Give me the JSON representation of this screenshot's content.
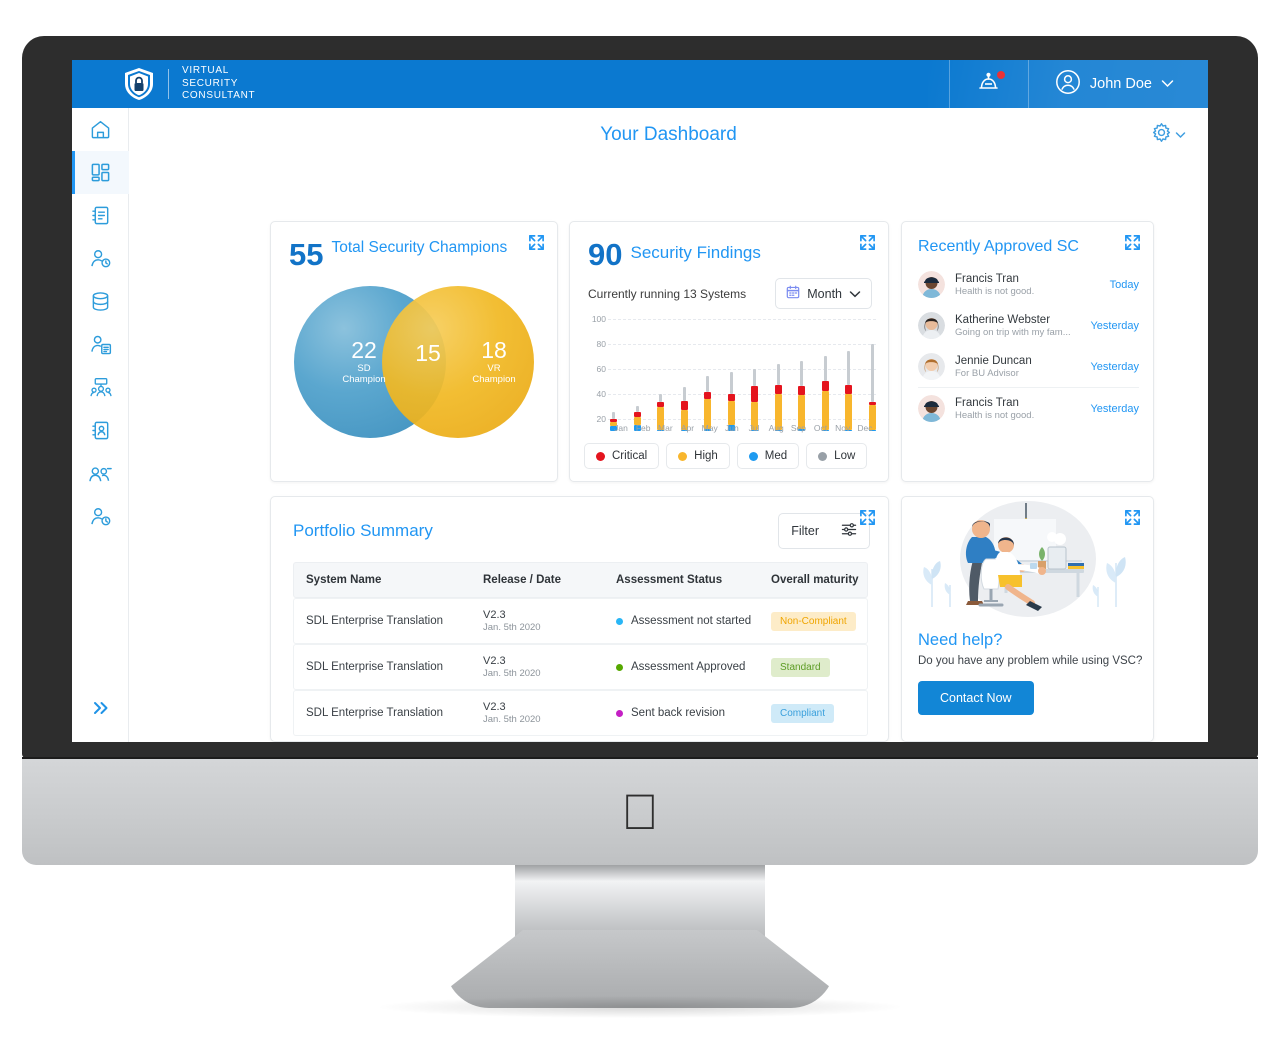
{
  "brand": {
    "line1": "VIRTUAL",
    "line2": "SECURITY",
    "line3": "CONSULTANT",
    "shield_icon": "shield-lock-icon"
  },
  "header": {
    "bell_icon": "service-bell-icon",
    "has_notification": true,
    "avatar_icon": "user-circle-icon",
    "user_name": "John Doe",
    "chevron_icon": "chevron-down-icon",
    "bg_color": "#0b79d0"
  },
  "sidebar": {
    "items": [
      {
        "icon": "home-icon",
        "name": "home",
        "active": false
      },
      {
        "icon": "dashboard-grid-icon",
        "name": "dashboard",
        "active": true
      },
      {
        "icon": "notebook-icon",
        "name": "notebook",
        "active": false
      },
      {
        "icon": "user-settings-icon",
        "name": "user-settings",
        "active": false
      },
      {
        "icon": "database-icon",
        "name": "database",
        "active": false
      },
      {
        "icon": "user-card-icon",
        "name": "user-card",
        "active": false
      },
      {
        "icon": "team-presentation-icon",
        "name": "team-presentation",
        "active": false
      },
      {
        "icon": "contact-book-icon",
        "name": "contact-book",
        "active": false
      },
      {
        "icon": "users-group-icon",
        "name": "users-group",
        "active": false
      },
      {
        "icon": "user-clock-icon",
        "name": "user-clock",
        "active": false
      }
    ],
    "collapse_icon": "double-chevron-right-icon"
  },
  "page": {
    "title": "Your Dashboard",
    "settings_icon": "gear-icon",
    "settings_chevron": "chevron-down-icon",
    "title_color": "#2196f3"
  },
  "champions_card": {
    "count": "55",
    "label": "Total Security Champions",
    "expand_icon": "expand-icon",
    "venn": {
      "left_value": "22",
      "left_label_1": "SD",
      "left_label_2": "Champion",
      "left_color": "#5ba7cf",
      "overlap_value": "15",
      "right_value": "18",
      "right_label_1": "VR",
      "right_label_2": "Champion",
      "right_color": "#f1b924"
    }
  },
  "findings_card": {
    "count": "90",
    "label": "Security Findings",
    "subtitle": "Currently running 13 Systems",
    "expand_icon": "expand-icon",
    "range_selector": {
      "icon": "calendar-icon",
      "value": "Month",
      "chevron": "chevron-down-icon"
    }
  },
  "chart_data": {
    "type": "bar",
    "title": "Security Findings",
    "subtitle": "Currently running 13 Systems",
    "xlabel": "",
    "ylabel": "",
    "ylim": [
      20,
      100
    ],
    "yticks": [
      20,
      40,
      60,
      80,
      100
    ],
    "grid": true,
    "stacked": true,
    "legend_position": "bottom",
    "categories": [
      "Jan",
      "Feb",
      "Mar",
      "Apr",
      "May",
      "Jun",
      "Jul",
      "Aug",
      "Sep",
      "Oct",
      "Nov",
      "Dec"
    ],
    "series": [
      {
        "name": "Med",
        "color": "#1f9bf0",
        "values": [
          24,
          25,
          21,
          21,
          22,
          25,
          21,
          21,
          22,
          21,
          21,
          21
        ]
      },
      {
        "name": "High",
        "color": "#f8b62d",
        "values": [
          27,
          31,
          39,
          37,
          46,
          44,
          43,
          50,
          49,
          52,
          50,
          41
        ]
      },
      {
        "name": "Critical",
        "color": "#e4141e",
        "values": [
          30,
          35,
          43,
          44,
          51,
          50,
          56,
          57,
          56,
          60,
          57,
          43
        ]
      },
      {
        "name": "Low",
        "color": "#c7ccd1",
        "values": [
          35,
          40,
          50,
          55,
          64,
          67,
          70,
          74,
          76,
          80,
          84,
          90
        ]
      }
    ],
    "legend": [
      {
        "label": "Critical",
        "color": "#e4141e"
      },
      {
        "label": "High",
        "color": "#f8b62d"
      },
      {
        "label": "Med",
        "color": "#1f9bf0"
      },
      {
        "label": "Low",
        "color": "#98a0a7"
      }
    ]
  },
  "approved_card": {
    "title": "Recently Approved SC",
    "expand_icon": "expand-icon",
    "items": [
      {
        "name": "Francis Tran",
        "note": "Health is not good.",
        "time": "Today",
        "avatar": "avatar-francis"
      },
      {
        "name": "Katherine Webster",
        "note": "Going on trip with my fam...",
        "time": "Yesterday",
        "avatar": "avatar-katherine"
      },
      {
        "name": "Jennie Duncan",
        "note": "For BU Advisor",
        "time": "Yesterday",
        "avatar": "avatar-jennie"
      },
      {
        "name": "Francis Tran",
        "note": "Health is not good.",
        "time": "Yesterday",
        "avatar": "avatar-francis"
      }
    ]
  },
  "portfolio_card": {
    "title": "Portfolio Summary",
    "expand_icon": "expand-icon",
    "filter": {
      "label": "Filter",
      "icon": "sliders-icon"
    },
    "columns": [
      "System Name",
      "Release / Date",
      "Assessment Status",
      "Overall maturity"
    ],
    "rows": [
      {
        "system": "SDL Enterprise Translation",
        "release": "V2.3",
        "date": "Jan. 5th 2020",
        "status": "Assessment not started",
        "status_color": "#29b6f6",
        "maturity": "Non-Compliant",
        "maturity_bg": "#fdecc8",
        "maturity_fg": "#f0a500"
      },
      {
        "system": "SDL Enterprise Translation",
        "release": "V2.3",
        "date": "Jan. 5th 2020",
        "status": "Assessment Approved",
        "status_color": "#56a800",
        "maturity": "Standard",
        "maturity_bg": "#dfeccb",
        "maturity_fg": "#5d9c24"
      },
      {
        "system": "SDL Enterprise Translation",
        "release": "V2.3",
        "date": "Jan. 5th 2020",
        "status": "Sent back revision",
        "status_color": "#c41fc4",
        "maturity": "Compliant",
        "maturity_bg": "#cfeaf8",
        "maturity_fg": "#3aa0dc"
      }
    ]
  },
  "help_card": {
    "title": "Need help?",
    "subtitle": "Do you have any problem while using VSC?",
    "button_label": "Contact Now",
    "expand_icon": "expand-icon",
    "illustration": "office-support-illustration"
  }
}
